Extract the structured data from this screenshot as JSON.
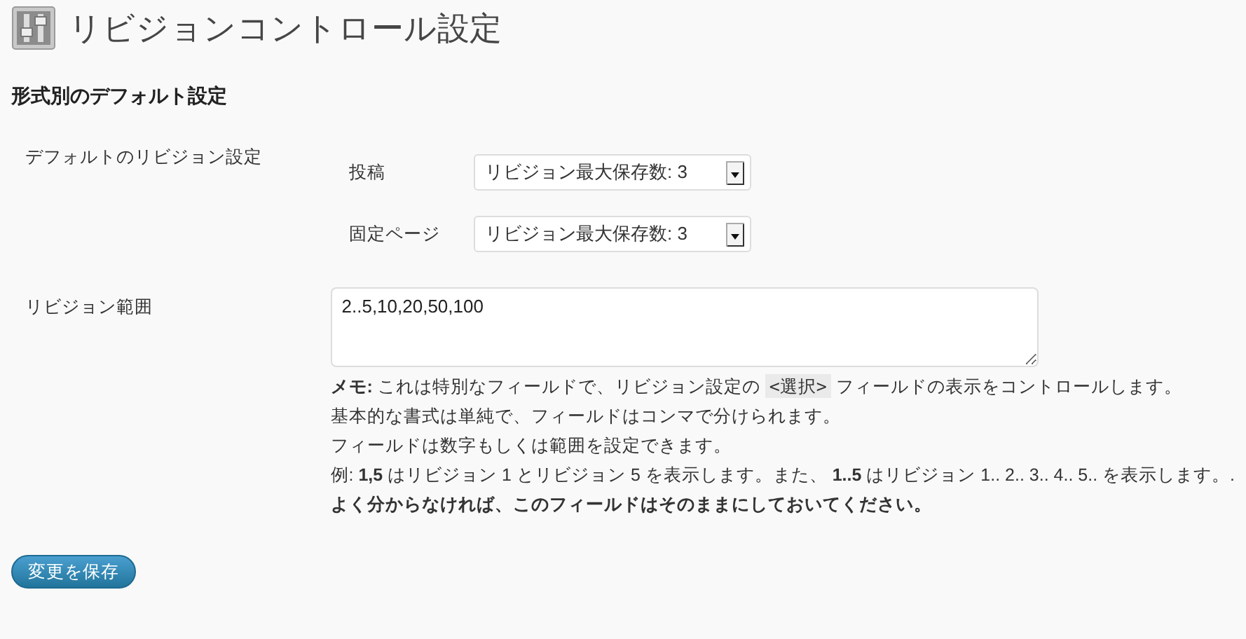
{
  "page_title": "リビジョンコントロール設定",
  "section_title": "形式別のデフォルト設定",
  "defaults": {
    "label": "デフォルトのリビジョン設定",
    "rows": [
      {
        "label": "投稿",
        "value": "リビジョン最大保存数: 3"
      },
      {
        "label": "固定ページ",
        "value": "リビジョン最大保存数: 3"
      }
    ]
  },
  "range": {
    "label": "リビジョン範囲",
    "value": "2..5,10,20,50,100",
    "memo": {
      "before": "**メモ:** これは特別なフィールドで、リビジョン設定の",
      "code": "<選択>",
      "after": "フィールドの表示をコントロールします。"
    },
    "notes": [
      "基本的な書式は単純で、フィールドはコンマで分けられます。",
      "フィールドは数字もしくは範囲を設定できます。",
      "例: **1,5** はリビジョン 1 とリビジョン 5 を表示します。また、 **1..5** はリビジョン 1.. 2.. 3.. 4.. 5.. を表示します。.",
      "**よく分からなければ、このフィールドはそのままにしておいてください。**"
    ]
  },
  "save_button": "変更を保存"
}
